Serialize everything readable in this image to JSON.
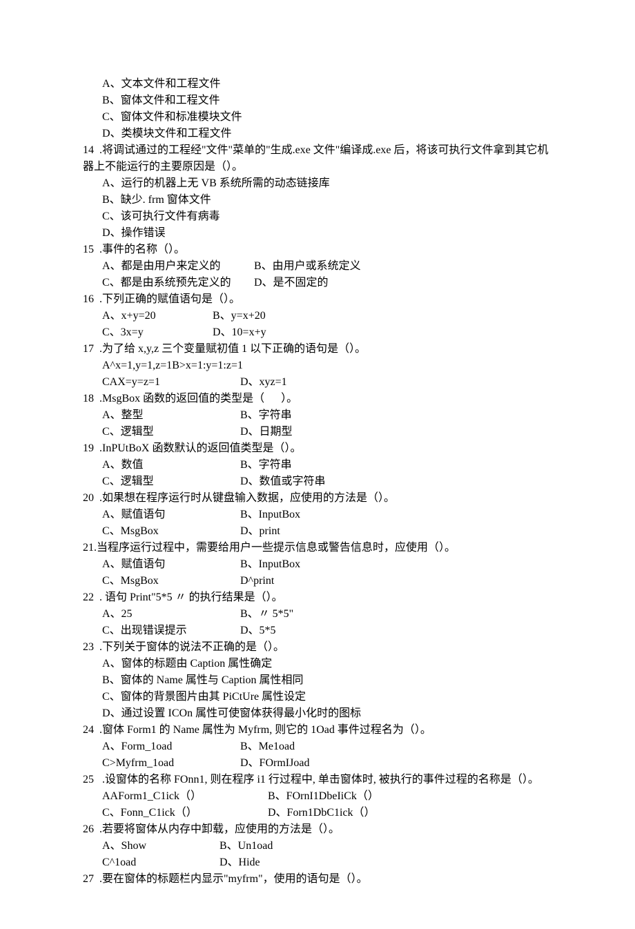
{
  "q13": {
    "a": "A、文本文件和工程文件",
    "b": "B、窗体文件和工程文件",
    "c": "C、窗体文件和标准模块文件",
    "d": "D、类模块文件和工程文件"
  },
  "q14": {
    "stem": "14  .将调试通过的工程经\"文件\"菜单的\"生成.exe 文件\"编译成.exe 后，将该可执行文件拿到其它机器上不能运行的主要原因是（）。",
    "a": "A、运行的机器上无 VB 系统所需的动态链接库",
    "b": "B、缺少. frm 窗体文件",
    "c": "C、该可执行文件有病毒",
    "d": "D、操作错误"
  },
  "q15": {
    "stem": "15  .事件的名称（）。",
    "a": "A、都是由用户来定义的",
    "b": "B、由用户或系统定义",
    "c": "C、都是由系统预先定义的",
    "d": "D、是不固定的"
  },
  "q16": {
    "stem": "16  .下列正确的赋值语句是（）。",
    "a": "A、x+y=20",
    "b": "B、y=x+20",
    "c": "C、3x=y",
    "d": "D、10=x+y"
  },
  "q17": {
    "stem": "17  .为了给 x,y,z 三个变量赋初值 1 以下正确的语句是（）。",
    "row1": "A^x=1,y=1,z=1B>x=1:y=1:z=1",
    "c": "CAX=y=z=1",
    "d": "D、xyz=1"
  },
  "q18": {
    "stem": "18  .MsgBox 函数的返回值的类型是（      ）。",
    "a": "A、整型",
    "b": "B、字符串",
    "c": "C、逻辑型",
    "d": "D、日期型"
  },
  "q19": {
    "stem": "19  .InPUtBoX 函数默认的返回值类型是（）。",
    "a": "A、数值",
    "b": "B、字符串",
    "c": "C、逻辑型",
    "d": "D、数值或字符串"
  },
  "q20": {
    "stem": "20  .如果想在程序运行时从键盘输入数据，应使用的方法是（）。",
    "a": "A、赋值语句",
    "b": "B、InputBox",
    "c": "C、MsgBox",
    "d": "D、print"
  },
  "q21": {
    "stem": "21.当程序运行过程中，需要给用户一些提示信息或警告信息时，应使用（）。",
    "a": "A、赋值语句",
    "b": "B、InputBox",
    "c": "C、MsgBox",
    "d": "D^print"
  },
  "q22": {
    "stem": "22  . 语句 Print\"5*5 〃 的执行结果是（）。",
    "a": "A、25",
    "b": "B、〃 5*5\"",
    "c": "C、出现错误提示",
    "d": "D、5*5"
  },
  "q23": {
    "stem": "23  .下列关于窗体的说法不正确的是（）。",
    "a": "A、窗体的标题由 Caption 属性确定",
    "b": "B、窗体的 Name 属性与 Caption 属性相同",
    "c": "C、窗体的背景图片由其 PiCtUre 属性设定",
    "d": "D、通过设置 ICOn 属性可使窗体获得最小化时的图标"
  },
  "q24": {
    "stem": "24  .窗体 Form1 的 Name 属性为 Myfrm, 则它的 1Oad 事件过程名为（）。",
    "a": "A、Form_1oad",
    "b": "B、Me1oad",
    "c": "C>Myfrm_1oad",
    "d": "D、FOrmIJoad"
  },
  "q25": {
    "stem": "25   .设窗体的名称 FOnn1, 则在程序 i1 行过程中, 单击窗体时, 被执行的事件过程的名称是（）。",
    "a": "AAForm1_C1ick（）",
    "b": "B、FOrnI1DbeIiCk（）",
    "c": "C、Fonn_C1ick（）",
    "d": "D、Forn1DbC1ick（）"
  },
  "q26": {
    "stem": "26  .若要将窗体从内存中卸载，应使用的方法是（）。",
    "a": "A、Show",
    "b": "B、Un1oad",
    "c": "C^1oad",
    "d": "D、Hide"
  },
  "q27": {
    "stem": "27  .要在窗体的标题栏内显示\"myfrm\"，使用的语句是（）。"
  }
}
